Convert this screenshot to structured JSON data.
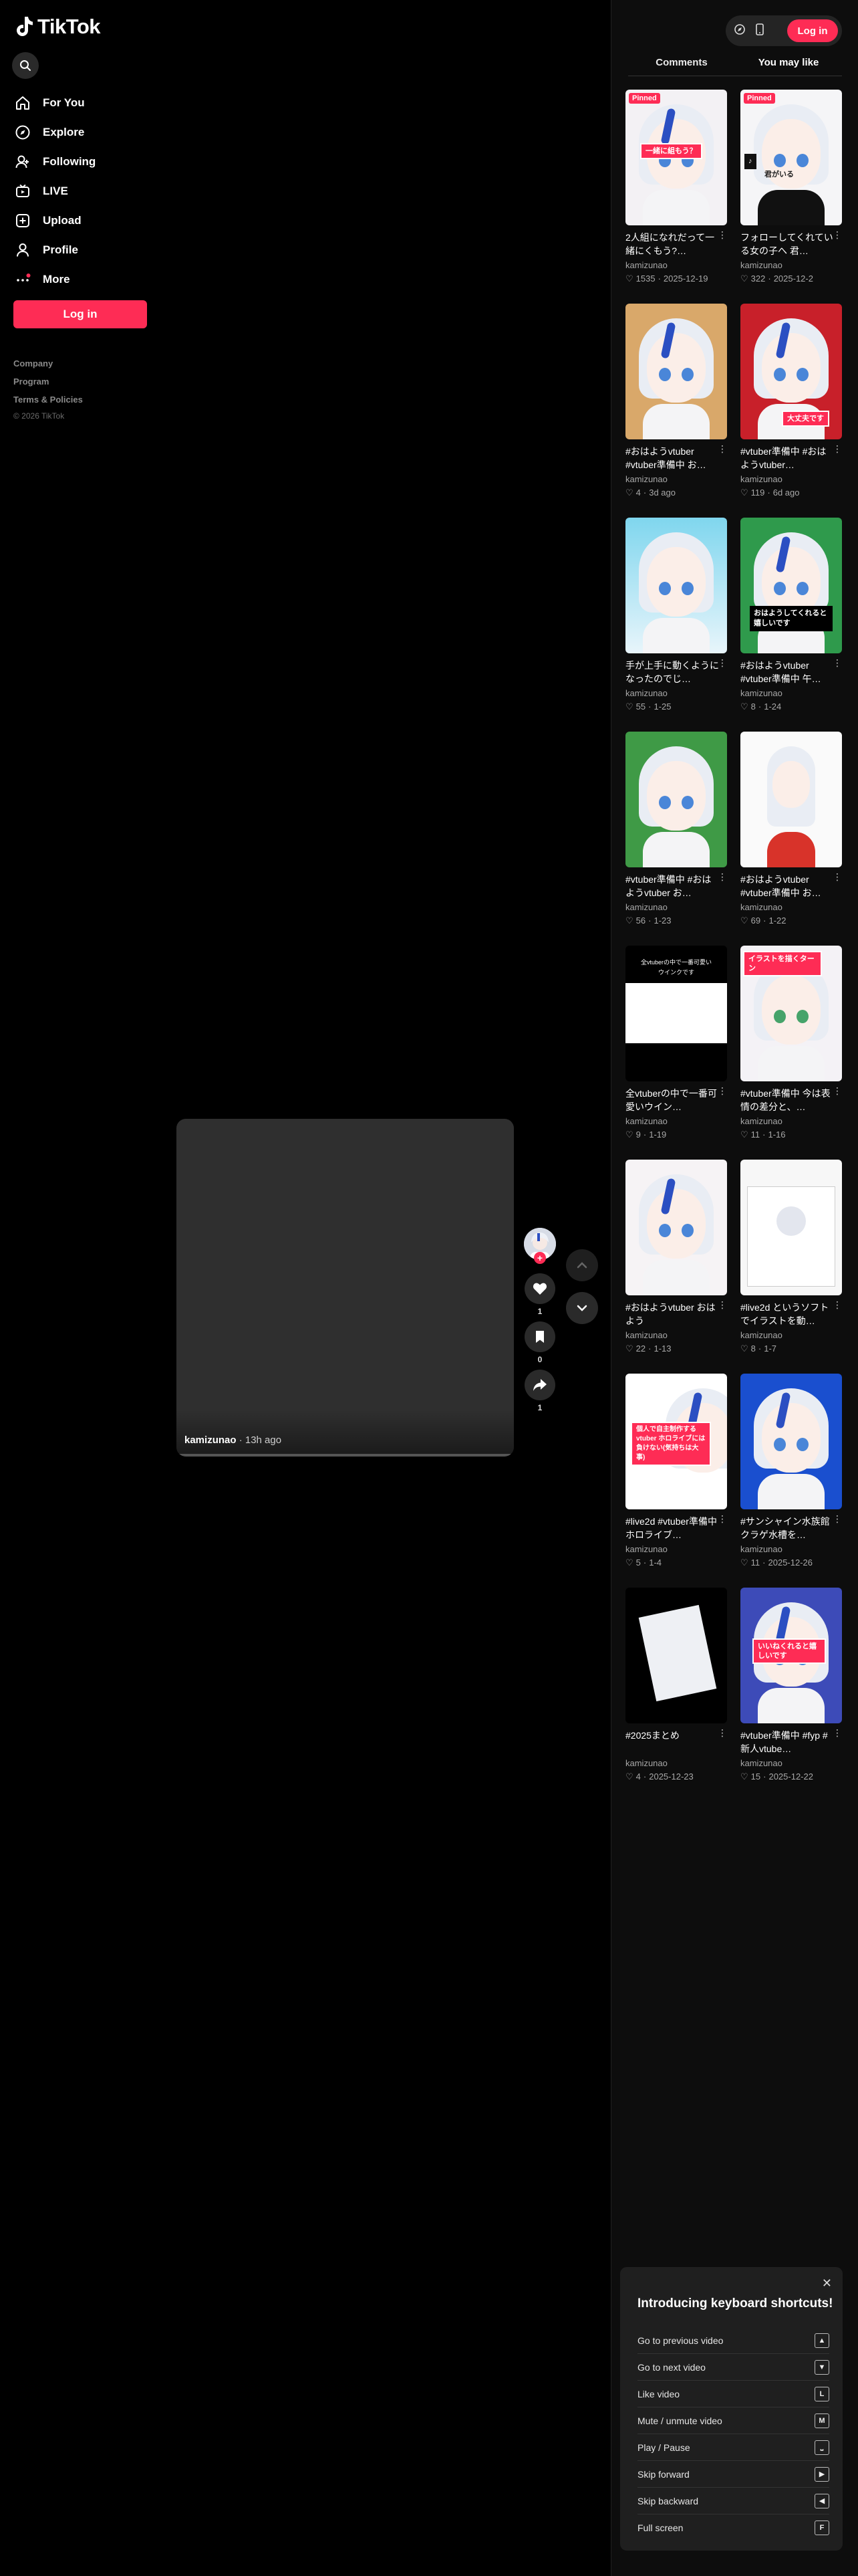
{
  "app": {
    "logo_text": "TikTok"
  },
  "sidebar": {
    "items": [
      {
        "label": "For You",
        "icon": "home-icon"
      },
      {
        "label": "Explore",
        "icon": "compass-icon"
      },
      {
        "label": "Following",
        "icon": "following-icon"
      },
      {
        "label": "LIVE",
        "icon": "live-icon"
      },
      {
        "label": "Upload",
        "icon": "upload-icon"
      },
      {
        "label": "Profile",
        "icon": "profile-icon"
      },
      {
        "label": "More",
        "icon": "more-icon"
      }
    ],
    "login_label": "Log in",
    "footer": {
      "company": "Company",
      "program": "Program",
      "terms": "Terms & Policies",
      "copyright": "© 2026 TikTok"
    }
  },
  "video": {
    "author": "kamizunao",
    "time": " · 13h ago",
    "likes": "1",
    "saves": "0",
    "shares": "1"
  },
  "header": {
    "login_label": "Log in"
  },
  "tabs": {
    "comments": "Comments",
    "you_may_like": "You may like"
  },
  "cards": [
    {
      "title": "2人組になれだって一緒にくもう?…",
      "user": "kamizunao",
      "likes": "1535",
      "date": "2025-12-19",
      "pinned": "Pinned",
      "overlay": "一緒に組もう？"
    },
    {
      "title": "フォローしてくれている女の子へ 君…",
      "user": "kamizunao",
      "likes": "322",
      "date": "2025-12-2",
      "pinned": "Pinned",
      "overlay": "君がいる"
    },
    {
      "title": "#おはようvtuber #vtuber準備中 お…",
      "user": "kamizunao",
      "likes": "4",
      "date": "3d ago"
    },
    {
      "title": "#vtuber準備中 #おはようvtuber…",
      "user": "kamizunao",
      "likes": "119",
      "date": "6d ago",
      "overlay": "大丈夫です"
    },
    {
      "title": "手が上手に動くようになったのでじ…",
      "user": "kamizunao",
      "likes": "55",
      "date": "1-25"
    },
    {
      "title": "#おはようvtuber #vtuber準備中 午…",
      "user": "kamizunao",
      "likes": "8",
      "date": "1-24",
      "overlay": "おはようしてくれると嬉しいです"
    },
    {
      "title": "#vtuber準備中 #おはようvtuber お…",
      "user": "kamizunao",
      "likes": "56",
      "date": "1-23"
    },
    {
      "title": "#おはようvtuber #vtuber準備中 お…",
      "user": "kamizunao",
      "likes": "69",
      "date": "1-22"
    },
    {
      "title": "全vtuberの中で一番可愛いウイン…",
      "user": "kamizunao",
      "likes": "9",
      "date": "1-19",
      "overlay": "全vtuberの中で一番可愛いウインクです"
    },
    {
      "title": "#vtuber準備中 今は表情の差分と、…",
      "user": "kamizunao",
      "likes": "11",
      "date": "1-16",
      "overlay": "イラストを描くターン"
    },
    {
      "title": "#おはようvtuber おはよう",
      "user": "kamizunao",
      "likes": "22",
      "date": "1-13"
    },
    {
      "title": "#live2d というソフトでイラストを動…",
      "user": "kamizunao",
      "likes": "8",
      "date": "1-7"
    },
    {
      "title": "#live2d #vtuber準備中 ホロライブ…",
      "user": "kamizunao",
      "likes": "5",
      "date": "1-4",
      "overlay": "個人で自主制作する vtuber ホロライブには負けない(気持ちは大事)"
    },
    {
      "title": "#サンシャイン水族館 クラゲ水槽を…",
      "user": "kamizunao",
      "likes": "11",
      "date": "2025-12-26"
    },
    {
      "title": "#2025まとめ",
      "user": "kamizunao",
      "likes": "4",
      "date": "2025-12-23"
    },
    {
      "title": "#vtuber準備中 #fyp #新人vtube…",
      "user": "kamizunao",
      "likes": "15",
      "date": "2025-12-22",
      "overlay": "いいねくれると嬉しいです"
    }
  ],
  "shortcuts": {
    "title": "Introducing keyboard shortcuts!",
    "items": [
      {
        "label": "Go to previous video",
        "key": "▲"
      },
      {
        "label": "Go to next video",
        "key": "▼"
      },
      {
        "label": "Like video",
        "key": "L"
      },
      {
        "label": "Mute / unmute video",
        "key": "M"
      },
      {
        "label": "Play / Pause",
        "key": "⎵"
      },
      {
        "label": "Skip forward",
        "key": "▶"
      },
      {
        "label": "Skip backward",
        "key": "◀"
      },
      {
        "label": "Full screen",
        "key": "F"
      }
    ]
  },
  "colors": {
    "accent": "#fe2c55",
    "background": "#000000",
    "panel": "#0d0d0d"
  }
}
